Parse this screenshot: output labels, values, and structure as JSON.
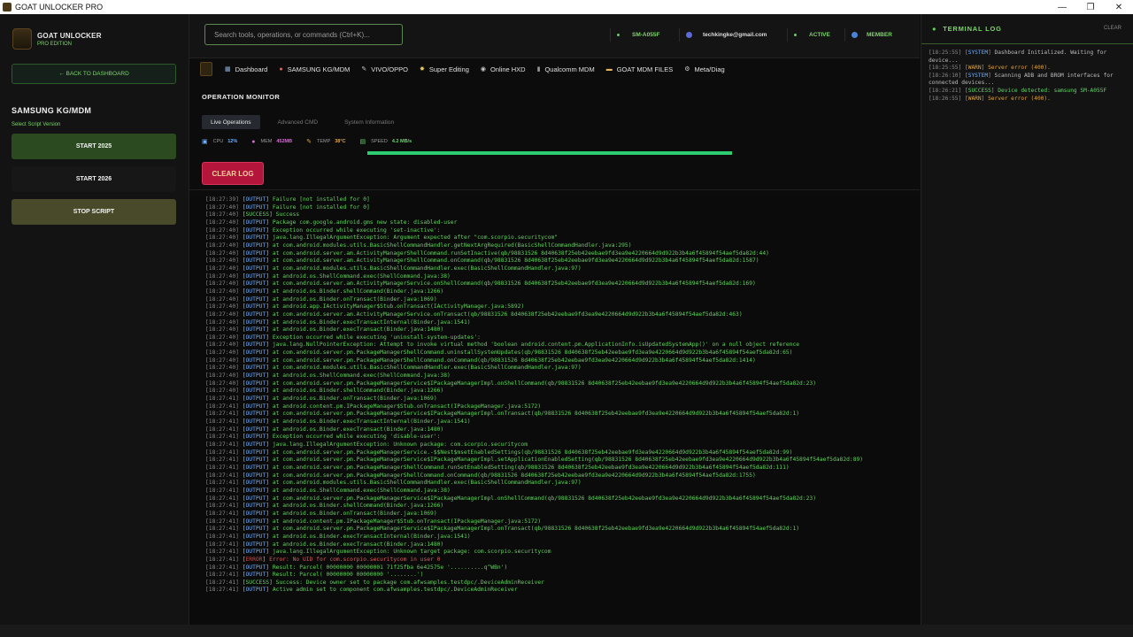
{
  "window": {
    "title": "GOAT UNLOCKER PRO",
    "minimize": "—",
    "maximize": "❐",
    "close": "✕"
  },
  "brand": {
    "title": "GOAT UNLOCKER",
    "subtitle": "PRO EDITION"
  },
  "sidebar": {
    "back_label": "← BACK TO DASHBOARD",
    "section_title": "SAMSUNG KG/MDM",
    "section_sub": "Select Script Version",
    "start_2025": "START 2025",
    "start_2026": "START 2026",
    "stop": "STOP SCRIPT"
  },
  "header": {
    "search_placeholder": "Search tools, operations, or commands (Ctrl+K)...",
    "device": "SM-A055F",
    "email": "techkingke@gmail.com",
    "status": "ACTIVE",
    "member": "MEMBER"
  },
  "nav": [
    {
      "icon": "▦",
      "label": "Dashboard",
      "color": "#8fb3e0"
    },
    {
      "icon": "●",
      "label": "SAMSUNG KG/MDM",
      "color": "#d86a6a"
    },
    {
      "icon": "✎",
      "label": "VIVO/OPPO",
      "color": "#c9c9c9"
    },
    {
      "icon": "✸",
      "label": "Super Editing",
      "color": "#e6c85a"
    },
    {
      "icon": "◉",
      "label": "Online HXD",
      "color": "#c9c9c9"
    },
    {
      "icon": "▮",
      "label": "Qualcomm MDM",
      "color": "#9a9a9a"
    },
    {
      "icon": "▬",
      "label": "GOAT MDM FILES",
      "color": "#e6b45a"
    },
    {
      "icon": "⚙",
      "label": "Meta/Diag",
      "color": "#c9c9c9"
    }
  ],
  "main": {
    "title": "OPERATION MONITOR",
    "tabs": [
      "Live Operations",
      "Advanced CMD",
      "System Information"
    ],
    "stats": [
      {
        "label": "CPU",
        "value": "12%",
        "color": "#6fb0ff",
        "icon": "▣"
      },
      {
        "label": "MEM",
        "value": "452MB",
        "color": "#d86ad8",
        "icon": "●"
      },
      {
        "label": "TEMP",
        "value": "38°C",
        "color": "#e6a23a",
        "icon": "✎"
      },
      {
        "label": "SPEED",
        "value": "4.2 MB/s",
        "color": "#63d66a",
        "icon": "▤"
      }
    ],
    "progress": 1.0,
    "clear_log": "CLEAR LOG"
  },
  "log": [
    {
      "ts": "[18:27:39]",
      "tag": "OUTPUT",
      "msg": "Failure [not installed for 0]"
    },
    {
      "ts": "[18:27:40]",
      "tag": "OUTPUT",
      "msg": "Failure [not installed for 0]"
    },
    {
      "ts": "[18:27:40]",
      "tag": "SUCCESS",
      "msg": "Success"
    },
    {
      "ts": "[18:27:40]",
      "tag": "OUTPUT",
      "msg": "Package com.google.android.gms new state: disabled-user"
    },
    {
      "ts": "[18:27:40]",
      "tag": "OUTPUT",
      "msg": "Exception occurred while executing 'set-inactive':"
    },
    {
      "ts": "[18:27:40]",
      "tag": "OUTPUT",
      "msg": "java.lang.IllegalArgumentException: Argument expected after \"com.scorpio.securitycom\""
    },
    {
      "ts": "[18:27:40]",
      "tag": "OUTPUT",
      "msg": "at com.android.modules.utils.BasicShellCommandHandler.getNextArgRequired(BasicShellCommandHandler.java:295)"
    },
    {
      "ts": "[18:27:40]",
      "tag": "OUTPUT",
      "msg": "at com.android.server.am.ActivityManagerShellCommand.runSetInactive(qb/98831526 8d40638f25eb42eebae9fd3ea9e4220664d9d922b3b4a6f45894f54aef5da82d:44)"
    },
    {
      "ts": "[18:27:40]",
      "tag": "OUTPUT",
      "msg": "at com.android.server.am.ActivityManagerShellCommand.onCommand(qb/98831526 8d40638f25eb42eebae9fd3ea9e4220664d9d922b3b4a6f45894f54aef5da82d:1587)"
    },
    {
      "ts": "[18:27:40]",
      "tag": "OUTPUT",
      "msg": "at com.android.modules.utils.BasicShellCommandHandler.exec(BasicShellCommandHandler.java:97)"
    },
    {
      "ts": "[18:27:40]",
      "tag": "OUTPUT",
      "msg": "at android.os.ShellCommand.exec(ShellCommand.java:38)"
    },
    {
      "ts": "[18:27:40]",
      "tag": "OUTPUT",
      "msg": "at com.android.server.am.ActivityManagerService.onShellCommand(qb/98831526 8d40638f25eb42eebae9fd3ea9e4220664d9d922b3b4a6f45894f54aef5da82d:169)"
    },
    {
      "ts": "[18:27:40]",
      "tag": "OUTPUT",
      "msg": "at android.os.Binder.shellCommand(Binder.java:1266)"
    },
    {
      "ts": "[18:27:40]",
      "tag": "OUTPUT",
      "msg": "at android.os.Binder.onTransact(Binder.java:1069)"
    },
    {
      "ts": "[18:27:40]",
      "tag": "OUTPUT",
      "msg": "at android.app.IActivityManager$Stub.onTransact(IActivityManager.java:5892)"
    },
    {
      "ts": "[18:27:40]",
      "tag": "OUTPUT",
      "msg": "at com.android.server.am.ActivityManagerService.onTransact(qb/98831526 8d40638f25eb42eebae9fd3ea9e4220664d9d922b3b4a6f45894f54aef5da82d:463)"
    },
    {
      "ts": "[18:27:40]",
      "tag": "OUTPUT",
      "msg": "at android.os.Binder.execTransactInternal(Binder.java:1541)"
    },
    {
      "ts": "[18:27:40]",
      "tag": "OUTPUT",
      "msg": "at android.os.Binder.execTransact(Binder.java:1480)"
    },
    {
      "ts": "[18:27:40]",
      "tag": "OUTPUT",
      "msg": "Exception occurred while executing 'uninstall-system-updates':"
    },
    {
      "ts": "[18:27:40]",
      "tag": "OUTPUT",
      "msg": "java.lang.NullPointerException: Attempt to invoke virtual method 'boolean android.content.pm.ApplicationInfo.isUpdatedSystemApp()' on a null object reference"
    },
    {
      "ts": "[18:27:40]",
      "tag": "OUTPUT",
      "msg": "at com.android.server.pm.PackageManagerShellCommand.uninstallSystemUpdates(qb/98831526 8d40638f25eb42eebae9fd3ea9e4220664d9d922b3b4a6f45894f54aef5da82d:65)"
    },
    {
      "ts": "[18:27:40]",
      "tag": "OUTPUT",
      "msg": "at com.android.server.pm.PackageManagerShellCommand.onCommand(qb/98831526 8d40638f25eb42eebae9fd3ea9e4220664d9d922b3b4a6f45894f54aef5da82d:1414)"
    },
    {
      "ts": "[18:27:40]",
      "tag": "OUTPUT",
      "msg": "at com.android.modules.utils.BasicShellCommandHandler.exec(BasicShellCommandHandler.java:97)"
    },
    {
      "ts": "[18:27:40]",
      "tag": "OUTPUT",
      "msg": "at android.os.ShellCommand.exec(ShellCommand.java:38)"
    },
    {
      "ts": "[18:27:40]",
      "tag": "OUTPUT",
      "msg": "at com.android.server.pm.PackageManagerService$IPackageManagerImpl.onShellCommand(qb/98831526 8d40638f25eb42eebae9fd3ea9e4220664d9d922b3b4a6f45894f54aef5da82d:23)"
    },
    {
      "ts": "[18:27:40]",
      "tag": "OUTPUT",
      "msg": "at android.os.Binder.shellCommand(Binder.java:1266)"
    },
    {
      "ts": "[18:27:41]",
      "tag": "OUTPUT",
      "msg": "at android.os.Binder.onTransact(Binder.java:1069)"
    },
    {
      "ts": "[18:27:41]",
      "tag": "OUTPUT",
      "msg": "at android.content.pm.IPackageManager$Stub.onTransact(IPackageManager.java:5172)"
    },
    {
      "ts": "[18:27:41]",
      "tag": "OUTPUT",
      "msg": "at com.android.server.pm.PackageManagerService$IPackageManagerImpl.onTransact(qb/98831526 8d40638f25eb42eebae9fd3ea9e4220664d9d922b3b4a6f45894f54aef5da82d:1)"
    },
    {
      "ts": "[18:27:41]",
      "tag": "OUTPUT",
      "msg": "at android.os.Binder.execTransactInternal(Binder.java:1541)"
    },
    {
      "ts": "[18:27:41]",
      "tag": "OUTPUT",
      "msg": "at android.os.Binder.execTransact(Binder.java:1480)"
    },
    {
      "ts": "[18:27:41]",
      "tag": "OUTPUT",
      "msg": "Exception occurred while executing 'disable-user':"
    },
    {
      "ts": "[18:27:41]",
      "tag": "OUTPUT",
      "msg": "java.lang.IllegalArgumentException: Unknown package: com.scorpio.securitycom"
    },
    {
      "ts": "[18:27:41]",
      "tag": "OUTPUT",
      "msg": "at com.android.server.pm.PackageManagerService.-$$Nest$msetEnabledSettings(qb/98831526 8d40638f25eb42eebae9fd3ea9e4220664d9d922b3b4a6f45894f54aef5da82d:99)"
    },
    {
      "ts": "[18:27:41]",
      "tag": "OUTPUT",
      "msg": "at com.android.server.pm.PackageManagerService$IPackageManagerImpl.setApplicationEnabledSetting(qb/98831526 8d40638f25eb42eebae9fd3ea9e4220664d9d922b3b4a6f45894f54aef5da82d:89)"
    },
    {
      "ts": "[18:27:41]",
      "tag": "OUTPUT",
      "msg": "at com.android.server.pm.PackageManagerShellCommand.runSetEnabledSetting(qb/98831526 8d40638f25eb42eebae9fd3ea9e4220664d9d922b3b4a6f45894f54aef5da82d:111)"
    },
    {
      "ts": "[18:27:41]",
      "tag": "OUTPUT",
      "msg": "at com.android.server.pm.PackageManagerShellCommand.onCommand(qb/98831526 8d40638f25eb42eebae9fd3ea9e4220664d9d922b3b4a6f45894f54aef5da82d:1755)"
    },
    {
      "ts": "[18:27:41]",
      "tag": "OUTPUT",
      "msg": "at com.android.modules.utils.BasicShellCommandHandler.exec(BasicShellCommandHandler.java:97)"
    },
    {
      "ts": "[18:27:41]",
      "tag": "OUTPUT",
      "msg": "at android.os.ShellCommand.exec(ShellCommand.java:38)"
    },
    {
      "ts": "[18:27:41]",
      "tag": "OUTPUT",
      "msg": "at com.android.server.pm.PackageManagerService$IPackageManagerImpl.onShellCommand(qb/98831526 8d40638f25eb42eebae9fd3ea9e4220664d9d922b3b4a6f45894f54aef5da82d:23)"
    },
    {
      "ts": "[18:27:41]",
      "tag": "OUTPUT",
      "msg": "at android.os.Binder.shellCommand(Binder.java:1266)"
    },
    {
      "ts": "[18:27:41]",
      "tag": "OUTPUT",
      "msg": "at android.os.Binder.onTransact(Binder.java:1069)"
    },
    {
      "ts": "[18:27:41]",
      "tag": "OUTPUT",
      "msg": "at android.content.pm.IPackageManager$Stub.onTransact(IPackageManager.java:5172)"
    },
    {
      "ts": "[18:27:41]",
      "tag": "OUTPUT",
      "msg": "at com.android.server.pm.PackageManagerService$IPackageManagerImpl.onTransact(qb/98831526 8d40638f25eb42eebae9fd3ea9e4220664d9d922b3b4a6f45894f54aef5da82d:1)"
    },
    {
      "ts": "[18:27:41]",
      "tag": "OUTPUT",
      "msg": "at android.os.Binder.execTransactInternal(Binder.java:1541)"
    },
    {
      "ts": "[18:27:41]",
      "tag": "OUTPUT",
      "msg": "at android.os.Binder.execTransact(Binder.java:1480)"
    },
    {
      "ts": "[18:27:41]",
      "tag": "OUTPUT",
      "msg": "java.lang.IllegalArgumentException: Unknown target package: com.scorpio.securitycom"
    },
    {
      "ts": "[18:27:41]",
      "tag": "ERROR",
      "msg": "Error: No UID for com.scorpio.securitycom in user 0"
    },
    {
      "ts": "[18:27:41]",
      "tag": "OUTPUT",
      "msg": "Result: Parcel( 00000000 00000001 71f25fba 6e42575e '..........q^WBn')"
    },
    {
      "ts": "[18:27:41]",
      "tag": "OUTPUT",
      "msg": "Result: Parcel( 00000000 00000000 '........')"
    },
    {
      "ts": "[18:27:41]",
      "tag": "SUCCESS",
      "msg": "Success: Device owner set to package com.afwsamples.testdpc/.DeviceAdminReceiver"
    },
    {
      "ts": "[18:27:41]",
      "tag": "OUTPUT",
      "msg": "Active admin set to component com.afwsamples.testdpc/.DeviceAdminReceiver"
    }
  ],
  "terminal": {
    "title": "TERMINAL LOG",
    "clear": "CLEAR",
    "entries": [
      {
        "ts": "[18:25:55]",
        "tag": "SYSTEM",
        "msg": "Dashboard Initialized. Waiting for",
        "cont": "device..."
      },
      {
        "ts": "[18:25:55]",
        "tag": "WARN",
        "msg": "Server error (400).",
        "cont": ""
      },
      {
        "ts": "[18:26:10]",
        "tag": "SYSTEM",
        "msg": "Scanning ADB and BROM interfaces for",
        "cont": "connected devices..."
      },
      {
        "ts": "[18:26:21]",
        "tag": "SUCCESS",
        "msg": "Device detected: samsung SM-A055F",
        "cont": ""
      },
      {
        "ts": "[18:26:55]",
        "tag": "WARN",
        "msg": "Server error (400).",
        "cont": ""
      }
    ]
  }
}
